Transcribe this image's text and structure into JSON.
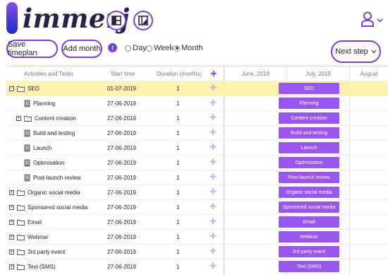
{
  "app": {
    "logo_text": "immerj"
  },
  "header": {
    "icons": [
      "dashboard-icon",
      "shapes-icon",
      "user-icon",
      "chevron-down-icon"
    ]
  },
  "toolbar": {
    "save_label": "Save timeplan",
    "add_month_label": "Add month",
    "info_glyph": "!",
    "view_options": [
      "Day",
      "Week",
      "Month"
    ],
    "selected_view": "Month",
    "next_step_label": "Next step"
  },
  "grid": {
    "columns": {
      "activities": "Activities and Tasks",
      "start": "Start time",
      "duration": "Duration (months)",
      "add_glyph": "✚"
    },
    "timeline_headers": [
      "June, 2019",
      "July, 2019",
      "August"
    ],
    "rows": [
      {
        "name": "SEO",
        "start": "01-07-2019",
        "duration": "1",
        "type": "folder",
        "expander": "−",
        "bar": "SEO",
        "highlight": true
      },
      {
        "name": "Planning",
        "start": "27-06-2019",
        "duration": "1",
        "type": "task",
        "bar": "Planning"
      },
      {
        "name": "Content creation",
        "start": "27-06-2019",
        "duration": "1",
        "type": "folder",
        "expander": "+",
        "bar": "Content creation"
      },
      {
        "name": "Build and testing",
        "start": "27-06-2019",
        "duration": "1",
        "type": "task",
        "bar": "Build and testing"
      },
      {
        "name": "Launch",
        "start": "27-06-2019",
        "duration": "1",
        "type": "task",
        "bar": "Launch"
      },
      {
        "name": "Optimisation",
        "start": "27-06-2019",
        "duration": "1",
        "type": "task",
        "bar": "Optimisation"
      },
      {
        "name": "Post-launch review",
        "start": "27-06-2019",
        "duration": "1",
        "type": "task",
        "bar": "Post-launch review"
      },
      {
        "name": "Organic social media",
        "start": "27-06-2019",
        "duration": "1",
        "type": "folder",
        "expander": "+",
        "bar": "Organic social media"
      },
      {
        "name": "Sponsored social media",
        "start": "27-06-2019",
        "duration": "1",
        "type": "folder",
        "expander": "+",
        "bar": "Sponsored social media"
      },
      {
        "name": "Email",
        "start": "27-06-2019",
        "duration": "1",
        "type": "folder",
        "expander": "+",
        "bar": "Email"
      },
      {
        "name": "Webinar",
        "start": "27-06-2019",
        "duration": "1",
        "type": "folder",
        "expander": "+",
        "bar": "Webinar"
      },
      {
        "name": "3rd party event",
        "start": "27-06-2019",
        "duration": "1",
        "type": "folder",
        "expander": "+",
        "bar": "3rd party event"
      },
      {
        "name": "Text (SMS)",
        "start": "27-06-2019",
        "duration": "1",
        "type": "folder",
        "expander": "+",
        "bar": "Text (SMS)"
      }
    ]
  },
  "colors": {
    "accent": "#7b3fe4",
    "bar": "#9a55f0",
    "highlight": "#fdf1b0",
    "logo_text": "#2a2148"
  }
}
